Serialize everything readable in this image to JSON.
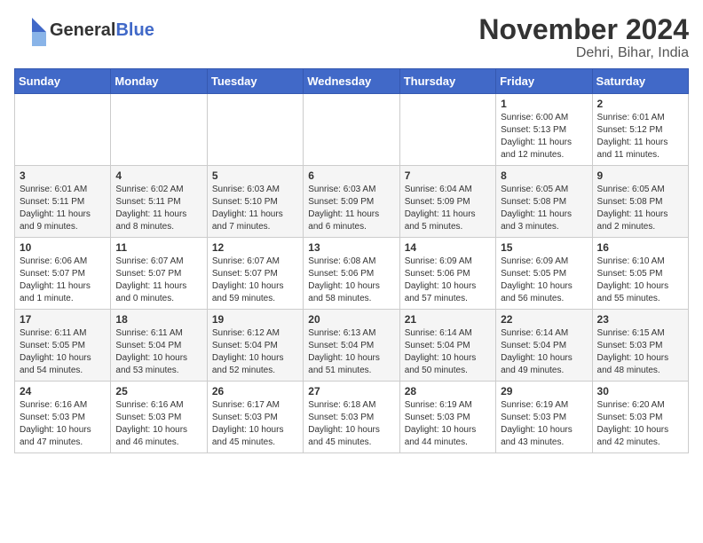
{
  "logo": {
    "general": "General",
    "blue": "Blue",
    "tagline": ""
  },
  "title": "November 2024",
  "subtitle": "Dehri, Bihar, India",
  "weekdays": [
    "Sunday",
    "Monday",
    "Tuesday",
    "Wednesday",
    "Thursday",
    "Friday",
    "Saturday"
  ],
  "weeks": [
    [
      {
        "day": "",
        "info": ""
      },
      {
        "day": "",
        "info": ""
      },
      {
        "day": "",
        "info": ""
      },
      {
        "day": "",
        "info": ""
      },
      {
        "day": "",
        "info": ""
      },
      {
        "day": "1",
        "info": "Sunrise: 6:00 AM\nSunset: 5:13 PM\nDaylight: 11 hours and 12 minutes."
      },
      {
        "day": "2",
        "info": "Sunrise: 6:01 AM\nSunset: 5:12 PM\nDaylight: 11 hours and 11 minutes."
      }
    ],
    [
      {
        "day": "3",
        "info": "Sunrise: 6:01 AM\nSunset: 5:11 PM\nDaylight: 11 hours and 9 minutes."
      },
      {
        "day": "4",
        "info": "Sunrise: 6:02 AM\nSunset: 5:11 PM\nDaylight: 11 hours and 8 minutes."
      },
      {
        "day": "5",
        "info": "Sunrise: 6:03 AM\nSunset: 5:10 PM\nDaylight: 11 hours and 7 minutes."
      },
      {
        "day": "6",
        "info": "Sunrise: 6:03 AM\nSunset: 5:09 PM\nDaylight: 11 hours and 6 minutes."
      },
      {
        "day": "7",
        "info": "Sunrise: 6:04 AM\nSunset: 5:09 PM\nDaylight: 11 hours and 5 minutes."
      },
      {
        "day": "8",
        "info": "Sunrise: 6:05 AM\nSunset: 5:08 PM\nDaylight: 11 hours and 3 minutes."
      },
      {
        "day": "9",
        "info": "Sunrise: 6:05 AM\nSunset: 5:08 PM\nDaylight: 11 hours and 2 minutes."
      }
    ],
    [
      {
        "day": "10",
        "info": "Sunrise: 6:06 AM\nSunset: 5:07 PM\nDaylight: 11 hours and 1 minute."
      },
      {
        "day": "11",
        "info": "Sunrise: 6:07 AM\nSunset: 5:07 PM\nDaylight: 11 hours and 0 minutes."
      },
      {
        "day": "12",
        "info": "Sunrise: 6:07 AM\nSunset: 5:07 PM\nDaylight: 10 hours and 59 minutes."
      },
      {
        "day": "13",
        "info": "Sunrise: 6:08 AM\nSunset: 5:06 PM\nDaylight: 10 hours and 58 minutes."
      },
      {
        "day": "14",
        "info": "Sunrise: 6:09 AM\nSunset: 5:06 PM\nDaylight: 10 hours and 57 minutes."
      },
      {
        "day": "15",
        "info": "Sunrise: 6:09 AM\nSunset: 5:05 PM\nDaylight: 10 hours and 56 minutes."
      },
      {
        "day": "16",
        "info": "Sunrise: 6:10 AM\nSunset: 5:05 PM\nDaylight: 10 hours and 55 minutes."
      }
    ],
    [
      {
        "day": "17",
        "info": "Sunrise: 6:11 AM\nSunset: 5:05 PM\nDaylight: 10 hours and 54 minutes."
      },
      {
        "day": "18",
        "info": "Sunrise: 6:11 AM\nSunset: 5:04 PM\nDaylight: 10 hours and 53 minutes."
      },
      {
        "day": "19",
        "info": "Sunrise: 6:12 AM\nSunset: 5:04 PM\nDaylight: 10 hours and 52 minutes."
      },
      {
        "day": "20",
        "info": "Sunrise: 6:13 AM\nSunset: 5:04 PM\nDaylight: 10 hours and 51 minutes."
      },
      {
        "day": "21",
        "info": "Sunrise: 6:14 AM\nSunset: 5:04 PM\nDaylight: 10 hours and 50 minutes."
      },
      {
        "day": "22",
        "info": "Sunrise: 6:14 AM\nSunset: 5:04 PM\nDaylight: 10 hours and 49 minutes."
      },
      {
        "day": "23",
        "info": "Sunrise: 6:15 AM\nSunset: 5:03 PM\nDaylight: 10 hours and 48 minutes."
      }
    ],
    [
      {
        "day": "24",
        "info": "Sunrise: 6:16 AM\nSunset: 5:03 PM\nDaylight: 10 hours and 47 minutes."
      },
      {
        "day": "25",
        "info": "Sunrise: 6:16 AM\nSunset: 5:03 PM\nDaylight: 10 hours and 46 minutes."
      },
      {
        "day": "26",
        "info": "Sunrise: 6:17 AM\nSunset: 5:03 PM\nDaylight: 10 hours and 45 minutes."
      },
      {
        "day": "27",
        "info": "Sunrise: 6:18 AM\nSunset: 5:03 PM\nDaylight: 10 hours and 45 minutes."
      },
      {
        "day": "28",
        "info": "Sunrise: 6:19 AM\nSunset: 5:03 PM\nDaylight: 10 hours and 44 minutes."
      },
      {
        "day": "29",
        "info": "Sunrise: 6:19 AM\nSunset: 5:03 PM\nDaylight: 10 hours and 43 minutes."
      },
      {
        "day": "30",
        "info": "Sunrise: 6:20 AM\nSunset: 5:03 PM\nDaylight: 10 hours and 42 minutes."
      }
    ]
  ]
}
